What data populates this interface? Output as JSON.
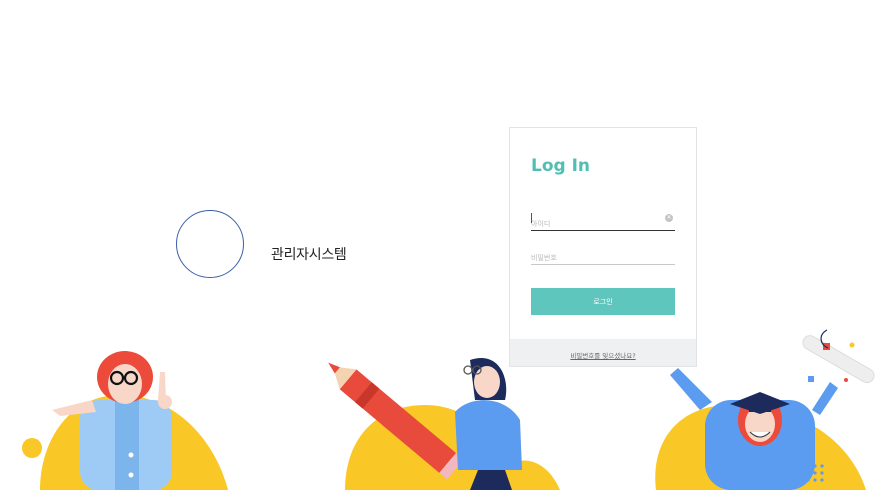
{
  "brand": {
    "system_name": "관리자시스템"
  },
  "login": {
    "title": "Log In",
    "id_placeholder": "아이디",
    "password_placeholder": "비밀번호",
    "button_label": "로그인",
    "find_password_link": "비밀번호를 잊으셨나요?"
  },
  "colors": {
    "accent": "#5fc6bd",
    "title_accent": "#4fbfb3",
    "logo_ring": "#3b5fa8",
    "illustration_yellow": "#f9c826",
    "illustration_blue": "#5b9bf0",
    "illustration_red": "#e84a3c"
  },
  "icons": {
    "clear": "clear-input-icon"
  }
}
